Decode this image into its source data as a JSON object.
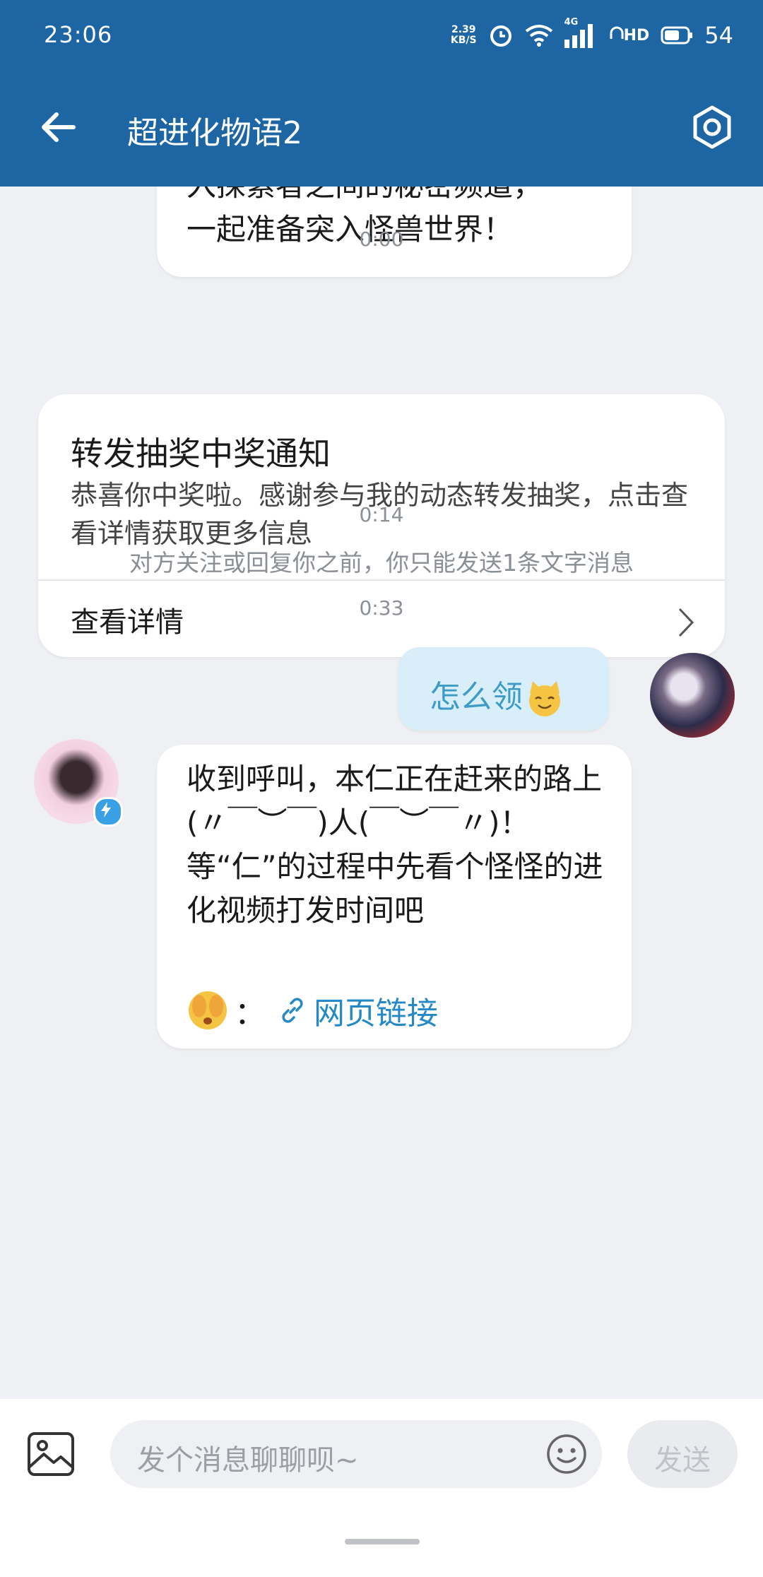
{
  "status_bar": {
    "time": "23:06",
    "net_speed_value": "2.39",
    "net_speed_unit": "KB/S",
    "network_label": "4G",
    "hd_label": "HD",
    "battery": "54"
  },
  "header": {
    "title": "超进化物语2"
  },
  "messages": {
    "prev_bubble_lines": [
      "入探索者之间的秘密频道，",
      "一起准备突入怪兽世界！"
    ],
    "timestamp_1": "0:00",
    "card": {
      "title": "转发抽奖中奖通知",
      "body": "恭喜你中奖啦。感谢参与我的动态转发抽奖，点击查看详情获取更多信息",
      "action": "查看详情"
    },
    "timestamp_2": "0:14",
    "notice": "对方关注或回复你之前，你只能发送1条文字消息",
    "timestamp_3": "0:33",
    "outgoing_text": "怎么领",
    "incoming_text": "收到呼叫，本仁正在赶来的路上(〃￣︶￣)人(￣︶￣〃)！\n等“仁”的过程中先看个怪怪的进化视频打发时间吧",
    "incoming_colon": "：",
    "incoming_link": "网页链接"
  },
  "input_bar": {
    "placeholder": "发个消息聊聊呗~",
    "send_label": "发送"
  },
  "colors": {
    "header_bg": "#1d66a3",
    "outgoing_bubble": "#d8eef9",
    "link": "#2489c6"
  }
}
